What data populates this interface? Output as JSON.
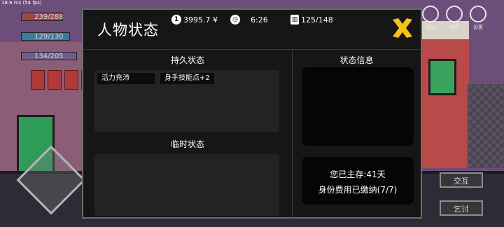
{
  "hud": {
    "fps": "18.6 ms (54 fps)",
    "bars": [
      "239/288",
      "129/130",
      "134/205"
    ],
    "skills": [
      "",
      "",
      "",
      ""
    ]
  },
  "top_icons": [
    "信息",
    "地图",
    "设置"
  ],
  "game_buttons": {
    "interact": "交互",
    "beg": "乞讨"
  },
  "panel": {
    "title": "人物状态",
    "money": "3995.7 ¥",
    "money_icon": "1",
    "time": "6:26",
    "inventory": "125/148",
    "sections": {
      "permanent": "持久状态",
      "temporary": "临时状态",
      "info": "状态信息"
    },
    "permanent_tags": [
      "活力充沛",
      "身手技能点+2"
    ],
    "survival_info": [
      "您已主存:41天",
      "身份费用已缴纳(7/7)"
    ]
  },
  "colors": {
    "close": "#f4c21a",
    "panel_bg": "#161616",
    "box_bg": "#232323"
  }
}
